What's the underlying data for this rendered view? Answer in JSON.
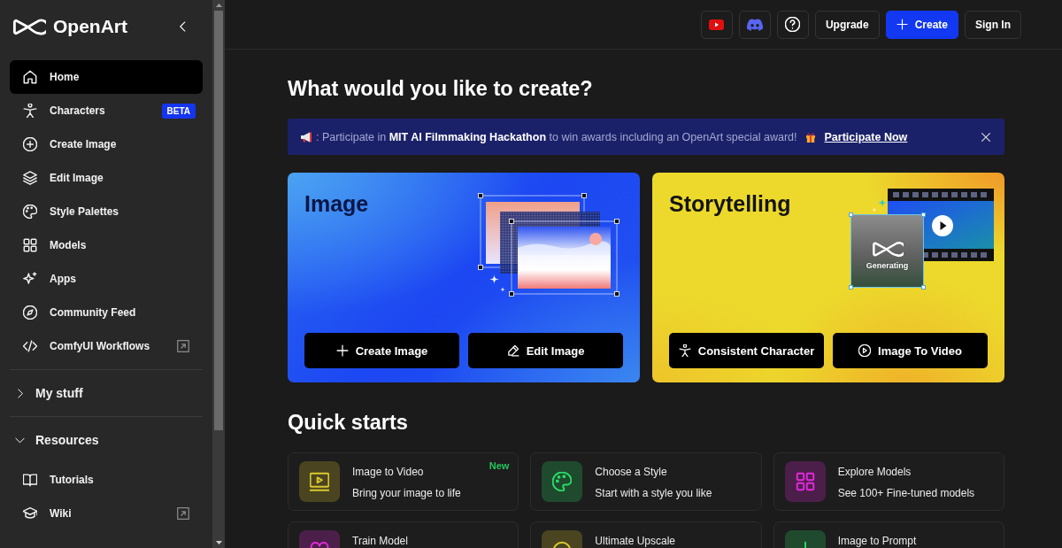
{
  "sidebar": {
    "logo_text": "OpenArt",
    "nav_items": [
      {
        "label": "Home",
        "selected": true,
        "external": false
      },
      {
        "label": "Characters",
        "selected": false,
        "external": false,
        "badge": "BETA"
      },
      {
        "label": "Create Image",
        "selected": false,
        "external": false
      },
      {
        "label": "Edit Image",
        "selected": false,
        "external": false
      },
      {
        "label": "Style Palettes",
        "selected": false,
        "external": false
      },
      {
        "label": "Models",
        "selected": false,
        "external": false
      },
      {
        "label": "Apps",
        "selected": false,
        "external": false
      },
      {
        "label": "Community Feed",
        "selected": false,
        "external": false
      },
      {
        "label": "ComfyUI Workflows",
        "selected": false,
        "external": true
      }
    ],
    "sections": [
      {
        "label": "My stuff",
        "expanded": false
      },
      {
        "label": "Resources",
        "expanded": true,
        "items": [
          {
            "label": "Tutorials",
            "selected": false,
            "external": false
          },
          {
            "label": "Wiki",
            "selected": false,
            "external": true
          }
        ]
      }
    ]
  },
  "top_bar": {
    "buttons": [
      {
        "label": "Upgrade",
        "primary": false
      },
      {
        "label": "Create",
        "primary": true
      },
      {
        "label": "Sign In",
        "primary": false
      }
    ]
  },
  "heading": "What would you like to create?",
  "banner": {
    "text": ": Participate in **MIT AI Filmmaking Hackathon** to win awards including an OpenArt special award!",
    "link": "Participate Now"
  },
  "feature_cards": [
    {
      "kind": "image",
      "title": "Image",
      "buttons": [
        "Create Image",
        "Edit Image"
      ]
    },
    {
      "kind": "storytelling",
      "title": "Storytelling",
      "status_label": "Generating",
      "buttons": [
        "Consistent Character",
        "Image To Video"
      ]
    }
  ],
  "quick_starts": {
    "heading": "Quick starts",
    "items": [
      {
        "title": "Image to Video",
        "description": "Bring your image to life",
        "badge": "New",
        "color": "#4a4520"
      },
      {
        "title": "Choose a Style",
        "description": "Start with a style you like",
        "color": "#1f4a2e"
      },
      {
        "title": "Explore Models",
        "description": "See 100+ Fine-tuned models",
        "color": "#4c1f4a"
      },
      {
        "title": "Train Model",
        "color": "#4c1f4a"
      },
      {
        "title": "Ultimate Upscale",
        "color": "#4a4520"
      },
      {
        "title": "Image to Prompt",
        "color": "#1f4a2e"
      }
    ]
  }
}
